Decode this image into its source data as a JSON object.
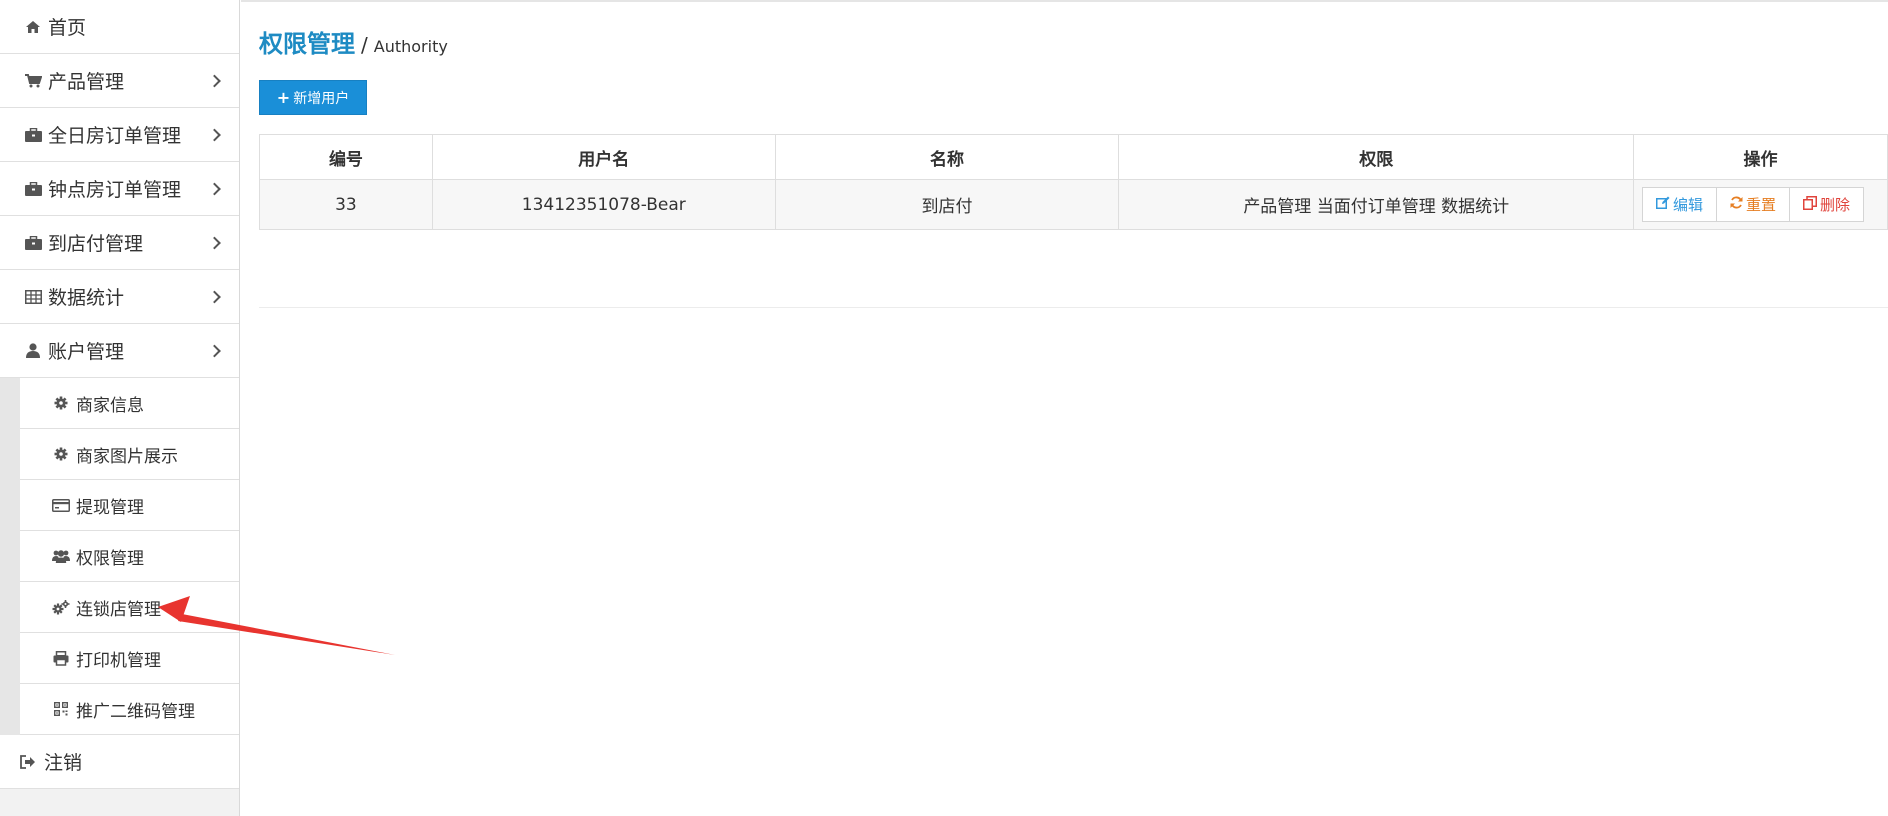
{
  "sidebar": {
    "items": [
      {
        "label": "首页",
        "icon": "home-icon"
      },
      {
        "label": "产品管理",
        "icon": "cart-icon"
      },
      {
        "label": "全日房订单管理",
        "icon": "briefcase-icon"
      },
      {
        "label": "钟点房订单管理",
        "icon": "briefcase-icon"
      },
      {
        "label": "到店付管理",
        "icon": "briefcase-icon"
      },
      {
        "label": "数据统计",
        "icon": "table-icon"
      },
      {
        "label": "账户管理",
        "icon": "user-icon"
      }
    ],
    "submenu": [
      {
        "label": "商家信息",
        "icon": "gear-icon"
      },
      {
        "label": "商家图片展示",
        "icon": "gear-icon"
      },
      {
        "label": "提现管理",
        "icon": "credit-card-icon"
      },
      {
        "label": "权限管理",
        "icon": "users-icon"
      },
      {
        "label": "连锁店管理",
        "icon": "gears-icon"
      },
      {
        "label": "打印机管理",
        "icon": "print-icon"
      },
      {
        "label": "推广二维码管理",
        "icon": "qrcode-icon"
      }
    ],
    "logout": {
      "label": "注销",
      "icon": "sign-out-icon"
    }
  },
  "header": {
    "title": "权限管理",
    "separator": "/",
    "subtitle": "Authority"
  },
  "toolbar": {
    "add_icon": "+",
    "add_label": "新增用户"
  },
  "table": {
    "columns": [
      "编号",
      "用户名",
      "名称",
      "权限",
      "操作"
    ],
    "rows": [
      {
        "id": "33",
        "username": "13412351078-Bear",
        "name": "到店付",
        "permissions": "产品管理 当面付订单管理 数据统计"
      }
    ],
    "actions": {
      "edit": "编辑",
      "reset": "重置",
      "delete": "删除"
    }
  },
  "colors": {
    "accent": "#1a8fd8",
    "title": "#1e8bc3",
    "annotation_arrow": "#e8342f"
  }
}
